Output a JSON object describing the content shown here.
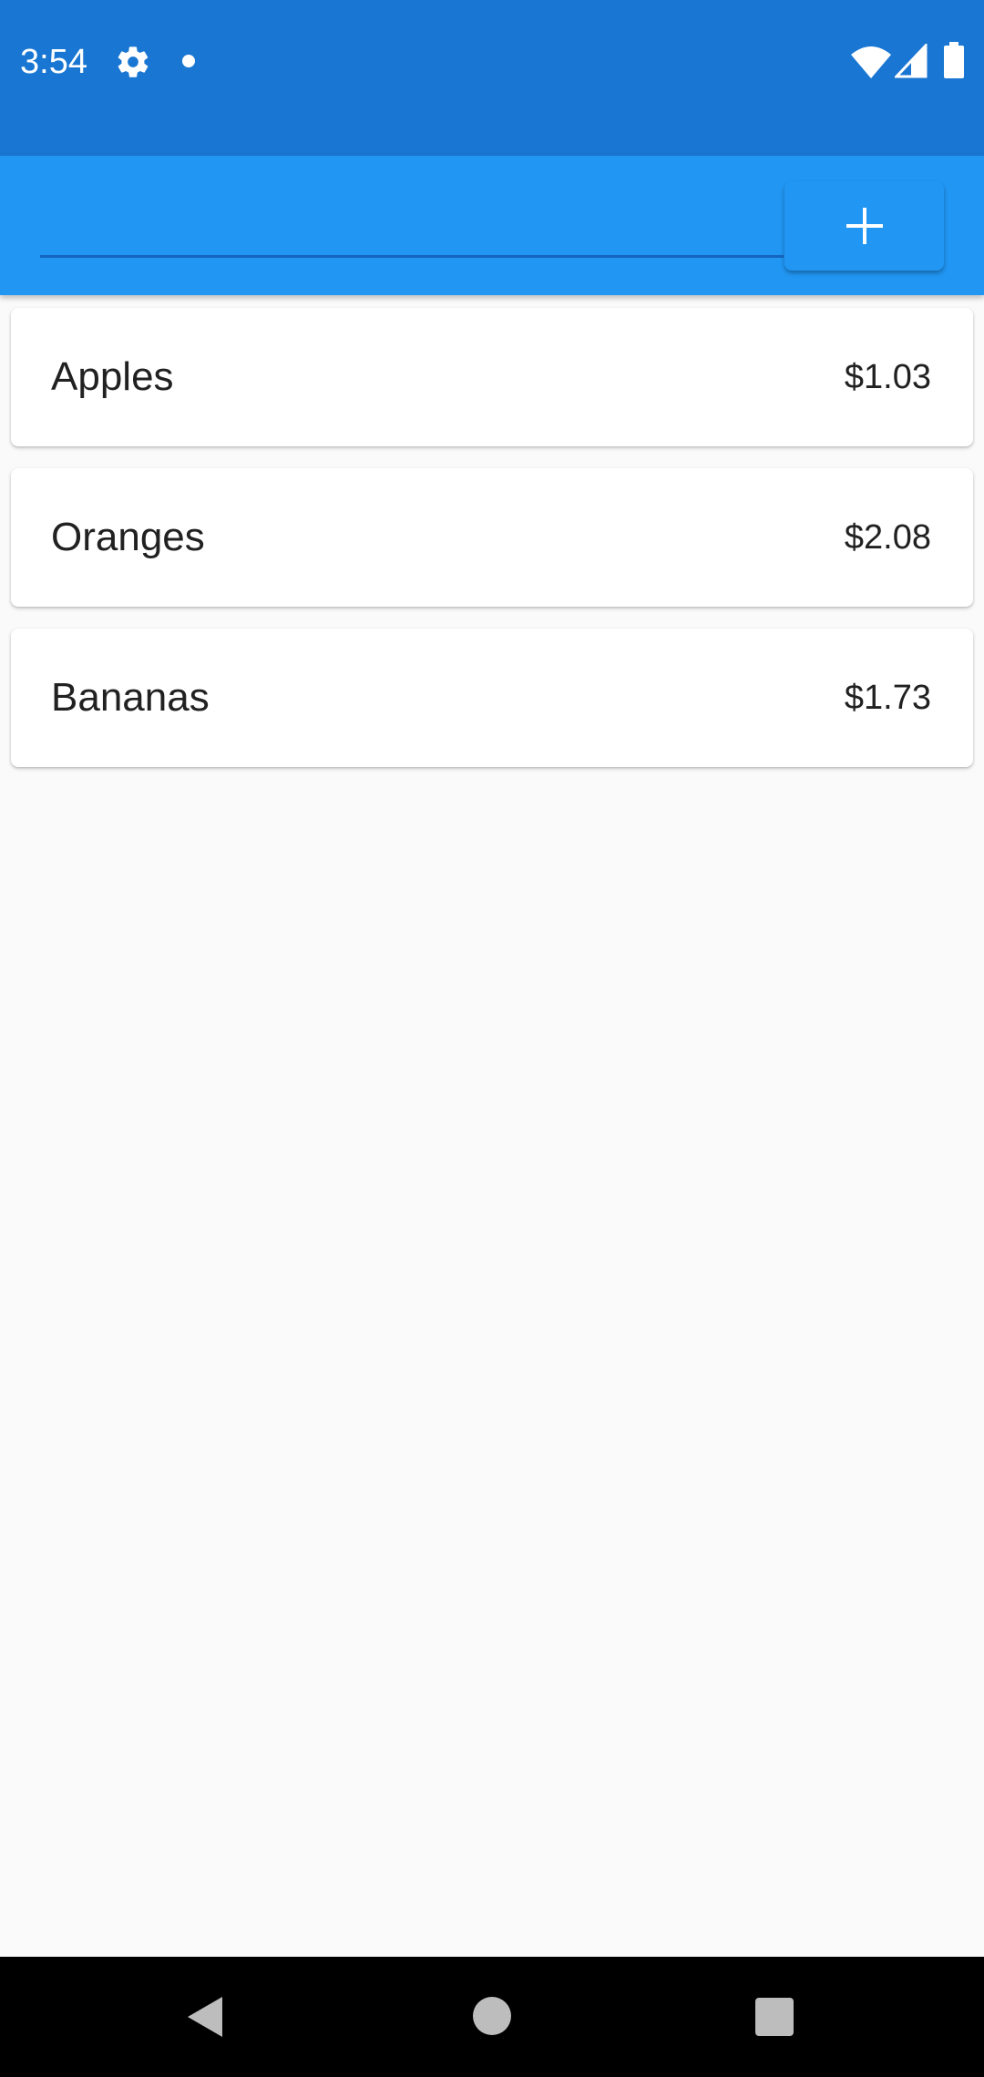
{
  "status_bar": {
    "time": "3:54",
    "icons": [
      "gear-icon",
      "notification-dot-icon",
      "wifi-icon",
      "signal-icon",
      "battery-icon"
    ]
  },
  "app_bar": {
    "input": {
      "value": "",
      "placeholder": ""
    },
    "add_button": {
      "icon": "plus-icon"
    },
    "colors": {
      "app_bar": "#2196f3",
      "status_bar": "#1976d2"
    }
  },
  "items": [
    {
      "name": "Apples",
      "price": "$1.03"
    },
    {
      "name": "Oranges",
      "price": "$2.08"
    },
    {
      "name": "Bananas",
      "price": "$1.73"
    }
  ],
  "nav_bar": {
    "icons": [
      "back-icon",
      "home-icon",
      "recents-icon"
    ]
  }
}
